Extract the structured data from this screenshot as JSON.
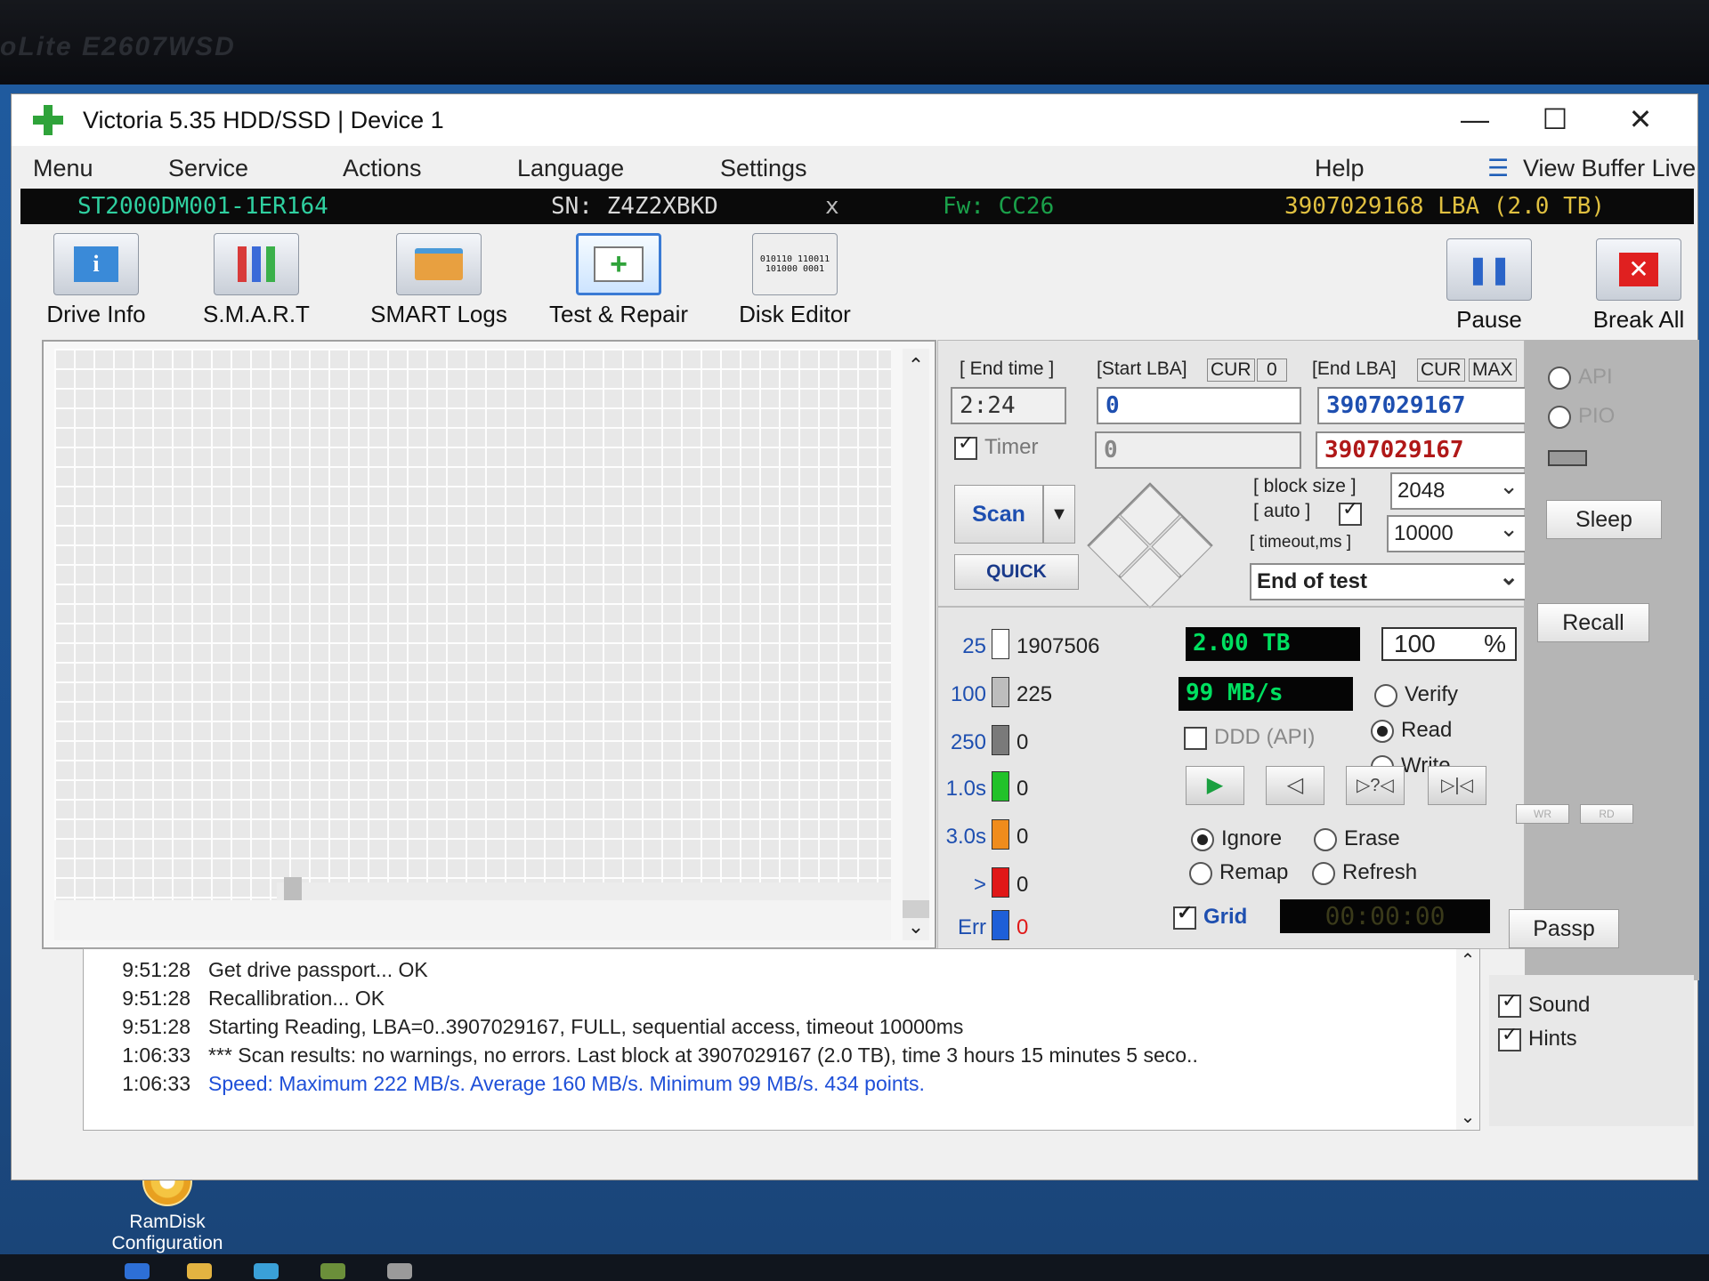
{
  "monitor": {
    "brand": "oLite E2607WSD"
  },
  "window": {
    "title": "Victoria 5.35 HDD/SSD | Device 1",
    "controls": {
      "minimize": "—",
      "maximize": "☐",
      "close": "✕"
    }
  },
  "menu": [
    "Menu",
    "Service",
    "Actions",
    "Language",
    "Settings",
    "Help",
    "View Buffer Live"
  ],
  "device": {
    "model": "ST2000DM001-1ER164",
    "serial": "SN: Z4Z2XBKD",
    "close": "x",
    "firmware": "Fw: CC26",
    "capacity": "3907029168 LBA (2.0 TB)"
  },
  "toolbar": {
    "drive_info": "Drive Info",
    "smart": "S.M.A.R.T",
    "smart_logs": "SMART Logs",
    "test_repair": "Test & Repair",
    "disk_editor": "Disk Editor",
    "pause": "Pause",
    "break_all": "Break All",
    "editor_bits": "010110 110011 101000 0001"
  },
  "scan": {
    "end_time_label": "[ End time ]",
    "end_time": "2:24",
    "start_lba_label": "[Start LBA]",
    "cur": "CUR",
    "zero": "0",
    "end_lba_label": "[End LBA]",
    "max": "MAX",
    "start_lba": "0",
    "end_lba": "3907029167",
    "timer_label": "Timer",
    "timer_value": "0",
    "end_lba_2": "3907029167",
    "scan_button": "Scan",
    "quick_button": "QUICK",
    "block_size_label": "[ block size ]",
    "auto_label": "[ auto ]",
    "timeout_label": "[ timeout,ms ]",
    "block_size": "2048",
    "timeout": "10000",
    "end_action": "End of test"
  },
  "counters": [
    {
      "label": "25",
      "count": "1907506",
      "color": "#ffffff"
    },
    {
      "label": "100",
      "count": "225",
      "color": "#bdbdbd"
    },
    {
      "label": "250",
      "count": "0",
      "color": "#7a7a7a"
    },
    {
      "label": "1.0s",
      "count": "0",
      "color": "#22c22a"
    },
    {
      "label": "3.0s",
      "count": "0",
      "color": "#f08c1c"
    },
    {
      "label": ">",
      "count": "0",
      "color": "#e01818"
    },
    {
      "label": "Err",
      "count": "0",
      "color": "#1e5fd8"
    }
  ],
  "status": {
    "size": "2.00 TB",
    "percent": "100",
    "percent_sign": "%",
    "speed": "99 MB/s",
    "ddd": "DDD (API)",
    "grid_label": "Grid",
    "timer_display": "00:00:00"
  },
  "modes": [
    "Verify",
    "Read",
    "Write"
  ],
  "actions": [
    "Ignore",
    "Erase",
    "Remap",
    "Refresh"
  ],
  "side": {
    "api": "API",
    "pio": "PIO",
    "sleep": "Sleep",
    "recall": "Recall",
    "wr": "WR",
    "rd": "RD",
    "passp": "Passp",
    "sound": "Sound",
    "hints": "Hints"
  },
  "log": [
    {
      "time": "9:51:28",
      "msg": "Get drive passport... OK"
    },
    {
      "time": "9:51:28",
      "msg": "Recallibration... OK"
    },
    {
      "time": "9:51:28",
      "msg": "Starting Reading, LBA=0..3907029167, FULL, sequential access, timeout 10000ms"
    },
    {
      "time": "1:06:33",
      "msg": "*** Scan results: no warnings, no errors. Last block at 3907029167 (2.0 TB), time 3 hours 15 minutes 5 seco.."
    },
    {
      "time": "1:06:33",
      "msg": "Speed: Maximum 222 MB/s. Average 160 MB/s. Minimum 99 MB/s. 434 points."
    }
  ],
  "desktop": {
    "icon_line1": "RamDisk",
    "icon_line2": "Configuration"
  }
}
